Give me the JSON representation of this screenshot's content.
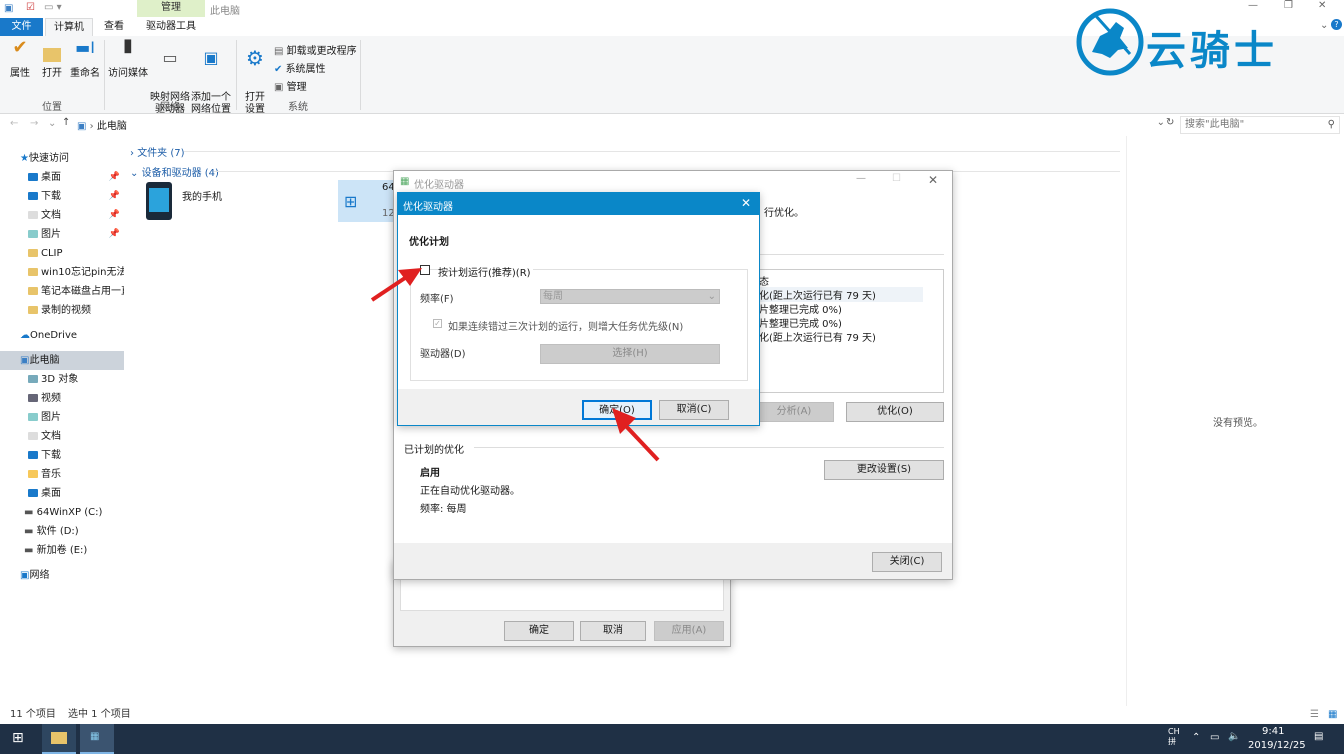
{
  "titlebar": {
    "context_tab": "管理",
    "title": "此电脑"
  },
  "ribbon": {
    "tabs": [
      "文件",
      "计算机",
      "查看",
      "驱动器工具"
    ],
    "buttons": {
      "properties": "属性",
      "open": "打开",
      "rename": "重命名",
      "access_media": "访问媒体",
      "map_drive": "映射网络\n驱动器",
      "add_location": "添加一个\n网络位置",
      "open_settings": "打开\n设置",
      "uninstall": "卸载或更改程序",
      "sys_props": "系统属性",
      "manage": "管理"
    },
    "groups": {
      "location": "位置",
      "network": "网络",
      "system": "系统"
    }
  },
  "address": {
    "path": "此电脑",
    "search_placeholder": "搜索\"此电脑\""
  },
  "nav": {
    "quick_access": "快速访问",
    "items": [
      "桌面",
      "下载",
      "文档",
      "图片",
      "CLIP",
      "win10忘记pin无法开",
      "笔记本磁盘占用一直",
      "录制的视频"
    ],
    "onedrive": "OneDrive",
    "this_pc": "此电脑",
    "pc_items": [
      "3D 对象",
      "视频",
      "图片",
      "文档",
      "下载",
      "音乐",
      "桌面",
      "64WinXP  (C:)",
      "软件 (D:)",
      "新加卷 (E:)"
    ],
    "network": "网络"
  },
  "content": {
    "folders": "文件夹 (7)",
    "devices": "设备和驱动器 (4)",
    "phone": "我的手机",
    "drive_label": "64",
    "drive_size": "12"
  },
  "preview": {
    "none": "没有预览。"
  },
  "status": {
    "items": "11 个项目",
    "selected": "选中 1 个项目"
  },
  "optimize_window": {
    "title": "优化驱动器",
    "partial_text": "行优化。",
    "status_header": "态",
    "rows": [
      "化(距上次运行已有 79 天)",
      "片整理已完成 0%)",
      "片整理已完成 0%)",
      "化(距上次运行已有 79 天)"
    ],
    "analyze": "分析(A)",
    "optimize": "优化(O)",
    "scheduled": "已计划的优化",
    "enabled": "启用",
    "auto_text": "正在自动优化驱动器。",
    "freq": "频率: 每周",
    "change_settings": "更改设置(S)",
    "close": "关闭(C)"
  },
  "props_window": {
    "ok": "确定",
    "cancel": "取消",
    "apply": "应用(A)"
  },
  "schedule_dialog": {
    "title": "优化驱动器",
    "heading": "优化计划",
    "run_schedule": "按计划运行(推荐)(R)",
    "freq_label": "频率(F)",
    "freq_value": "每周",
    "missed_label": "如果连续错过三次计划的运行，则增大任务优先级(N)",
    "drives_label": "驱动器(D)",
    "choose": "选择(H)",
    "ok": "确定(O)",
    "cancel": "取消(C)"
  },
  "watermark": {
    "text": "云骑士"
  },
  "taskbar": {
    "lang": "CH\n拼",
    "time": "9:41",
    "date": "2019/12/25"
  },
  "colors": {
    "accent": "#0a87c8",
    "file_tab": "#1979ca",
    "arrow": "#e02020"
  }
}
